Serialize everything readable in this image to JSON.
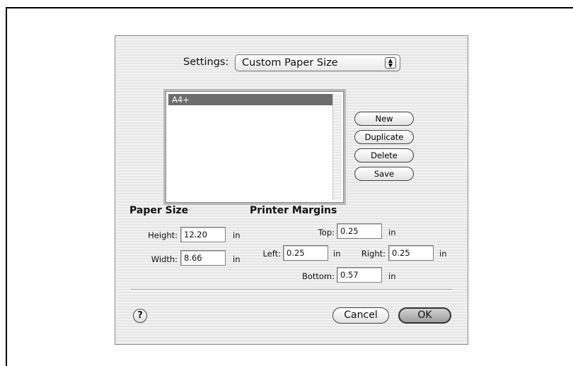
{
  "settings": {
    "label": "Settings:",
    "value": "Custom Paper Size"
  },
  "paper_list": {
    "items": [
      "A4+"
    ],
    "selected": "A4+"
  },
  "side_buttons": {
    "new": "New",
    "duplicate": "Duplicate",
    "delete": "Delete",
    "save": "Save"
  },
  "paper_size": {
    "title": "Paper Size",
    "height_label": "Height:",
    "height_value": "12.20",
    "height_unit": "in",
    "width_label": "Width:",
    "width_value": "8.66",
    "width_unit": "in"
  },
  "printer_margins": {
    "title": "Printer Margins",
    "top_label": "Top:",
    "top_value": "0.25",
    "top_unit": "in",
    "left_label": "Left:",
    "left_value": "0.25",
    "left_unit": "in",
    "right_label": "Right:",
    "right_value": "0.25",
    "right_unit": "in",
    "bottom_label": "Bottom:",
    "bottom_value": "0.57",
    "bottom_unit": "in"
  },
  "footer": {
    "help": "?",
    "cancel": "Cancel",
    "ok": "OK"
  },
  "icons": {
    "popup": "up-down-arrows-icon",
    "help": "question-mark-icon"
  }
}
